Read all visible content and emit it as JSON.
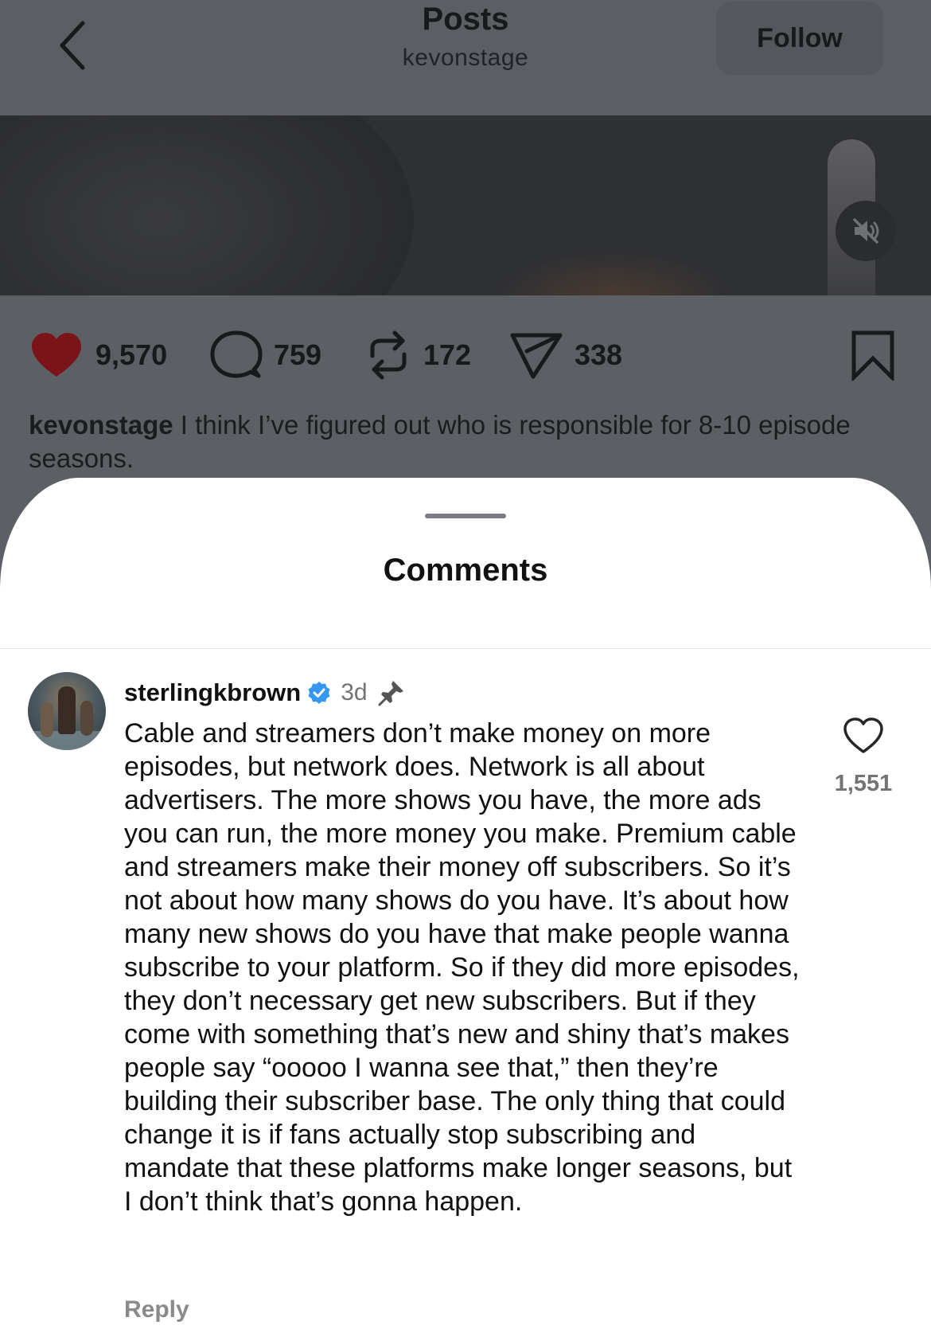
{
  "header": {
    "title": "Posts",
    "subtitle": "kevonstage",
    "follow_label": "Follow"
  },
  "post": {
    "likes": "9,570",
    "comments": "759",
    "reposts": "172",
    "shares": "338",
    "caption_user": "kevonstage",
    "caption_text": " I think I’ve figured out who is responsible for 8-10 episode seasons."
  },
  "comments_sheet": {
    "title": "Comments",
    "comment": {
      "username": "sterlingkbrown",
      "time": "3d",
      "text": "Cable and streamers don’t make money on more episodes, but network does. Network is all about advertisers. The more shows you have, the more ads you can run, the more money you make. Premium cable and streamers make their money off subscribers. So it’s not about how many shows do you have. It’s about how many new shows do you have that make people wanna subscribe to your platform. So if they did more episodes, they don’t necessary get new subscribers. But if they come with something that’s new and shiny that’s makes people say “ooooo I wanna see that,” then they’re building their subscriber base. The only thing that could change it is if fans actually stop subscribing and mandate that these platforms make longer seasons, but I don’t think that’s gonna happen.",
      "like_count": "1,551",
      "reply_label": "Reply"
    }
  },
  "icons": {
    "back": "chevron-left-icon",
    "mute": "speaker-muted-icon",
    "like": "heart-filled-icon",
    "comment": "speech-bubble-icon",
    "repost": "repost-arrows-icon",
    "share": "paper-plane-icon",
    "save": "bookmark-icon",
    "verified": "verified-badge-icon",
    "pin": "pin-icon",
    "comment_like": "heart-outline-icon"
  },
  "colors": {
    "like_red": "#7a1419",
    "verified_blue": "#3797f0",
    "overlay_gray": "#5c5f63"
  }
}
